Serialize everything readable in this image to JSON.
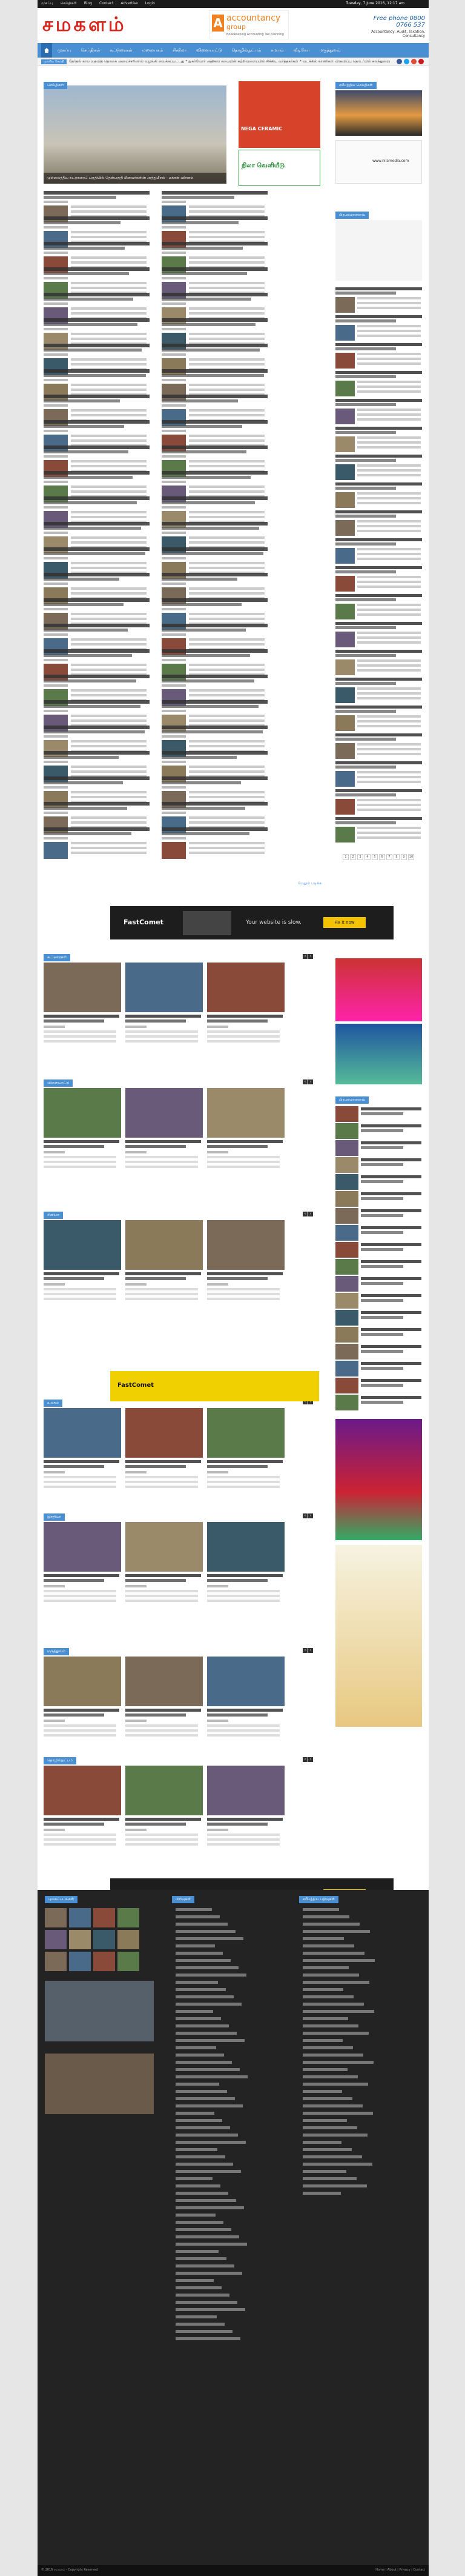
{
  "topbar": {
    "links": [
      "முகப்பு",
      "செய்திகள்",
      "Blog",
      "Contact",
      "Advertise",
      "Login"
    ],
    "date": "Tuesday, 7 June 2016, 12:17 am"
  },
  "header": {
    "logo_text": "சமகளம்",
    "ad_brand_1": "accountancy",
    "ad_brand_2": "group",
    "ad_tagline": "Bookkeeping Accounting Tax planning",
    "ad_phone": "Free phone 0800 0766 537",
    "ad_phone_sub": "Accountancy, Audit, Taxation, Consultancy"
  },
  "nav": {
    "items": [
      "முகப்பு",
      "செய்திகள்",
      "கட்டுரைகள்",
      "மலையகம்",
      "சினிமா",
      "விளையாட்டு",
      "தொழில்நுட்பம்",
      "சமயம்",
      "வீடியோ",
      "மருத்துவம்",
      "இந்தியா",
      "உலகம்"
    ]
  },
  "ticker": {
    "label": "முக்கிய செய்தி",
    "text": "தேர்தல் கால உதவித் தொகை அமைச்சரினால் வழங்கி வைக்கப்பட்டது * நுகர்வோர் அதிகார சபையின் சுற்றிவளைப்பில் சிக்கிய வர்த்தகர்கள் * வடக்கில் காணிகள் விடுவிப்பு தொடர்பில் கலந்துரையாடல்"
  },
  "featured": {
    "caption": "முல்லைத்தீவு கடற்கரைப் பகுதியில் தென்பகுதி மீனவர்களின் அத்துமீறல் - மக்கள் விசனம்"
  },
  "ads": {
    "ceramic_title": "NEGA CERAMIC",
    "nila_title": "நிலா வெளியீடு",
    "fastcomet_brand": "FastComet",
    "fastcomet_msg": "Your website is slow.",
    "fastcomet_btn": "Fix it now",
    "site_url": "www.nilamedia.com"
  },
  "sections": {
    "news": "செய்திகள்",
    "articles": "கட்டுரைகள்",
    "sports": "விளையாட்டு",
    "cinema": "சினிமா",
    "world": "உலகம்",
    "india": "இந்தியா",
    "medicine": "மருத்துவம்",
    "tech": "தொழில்நுட்பம்",
    "latest": "சமீபத்திய செய்திகள்",
    "popular": "பிரபலமானவை",
    "more": "மேலும் படிக்க"
  },
  "pagination": [
    "1",
    "2",
    "3",
    "4",
    "5",
    "6",
    "7",
    "8",
    "9",
    "10"
  ],
  "footer": {
    "col1_title": "புகைப்படங்கள்",
    "col2_title": "பிரிவுகள்",
    "col3_title": "சமீபத்திய பதிவுகள்",
    "copyright": "© 2016 சமகளம் - Copyright Reserved",
    "footer_links": "Home | About | Privacy | Contact"
  }
}
